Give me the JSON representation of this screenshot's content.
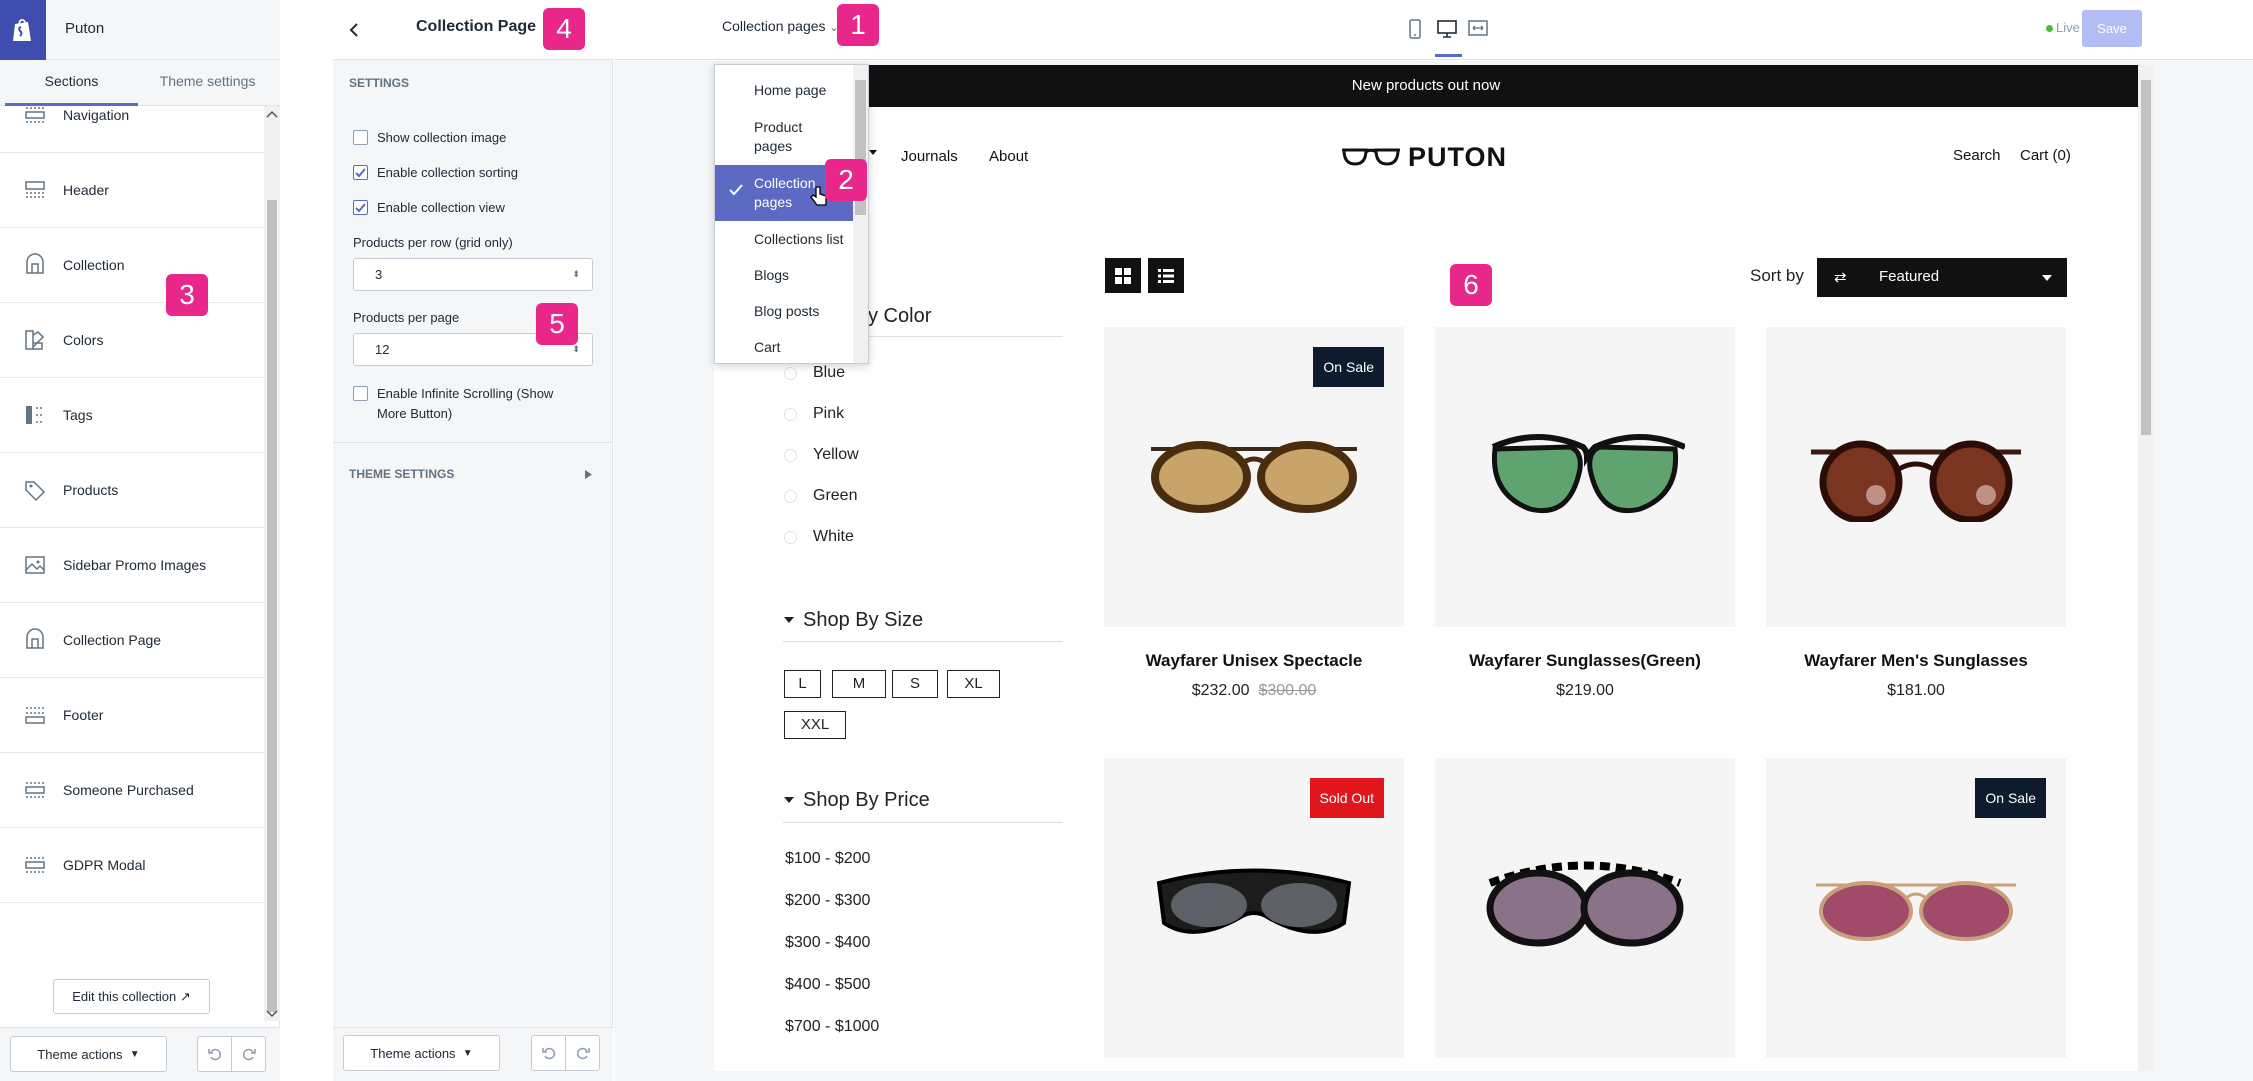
{
  "store": {
    "name": "Puton"
  },
  "left_tabs": [
    "Sections",
    "Theme settings"
  ],
  "sections": [
    {
      "label": "Navigation",
      "icon": "navigation-section-icon"
    },
    {
      "label": "Header",
      "icon": "header-section-icon"
    },
    {
      "label": "Collection",
      "icon": "collection-section-icon"
    },
    {
      "label": "Colors",
      "icon": "colors-section-icon"
    },
    {
      "label": "Tags",
      "icon": "tags-section-icon"
    },
    {
      "label": "Products",
      "icon": "products-tag-icon"
    },
    {
      "label": "Sidebar Promo Images",
      "icon": "image-icon"
    },
    {
      "label": "Collection Page",
      "icon": "collection-page-section-icon"
    },
    {
      "label": "Footer",
      "icon": "footer-section-icon"
    },
    {
      "label": "Someone Purchased",
      "icon": "someone-purchased-section-icon"
    },
    {
      "label": "GDPR Modal",
      "icon": "gdpr-section-icon"
    }
  ],
  "left_footer": {
    "edit_collection": "Edit this collection",
    "theme_actions": "Theme actions"
  },
  "panel": {
    "title": "Collection Page",
    "settings_label": "SETTINGS",
    "checkboxes": [
      {
        "label": "Show collection image",
        "checked": false
      },
      {
        "label": "Enable collection sorting",
        "checked": true
      },
      {
        "label": "Enable collection view",
        "checked": true
      }
    ],
    "per_row_label": "Products per row (grid only)",
    "per_row_value": "3",
    "per_page_label": "Products per page",
    "per_page_value": "12",
    "infinite_label_1": "Enable Infinite Scrolling (Show",
    "infinite_label_2": "More Button)",
    "infinite_checked": false,
    "theme_settings_label": "THEME SETTINGS",
    "theme_actions": "Theme actions"
  },
  "topbar": {
    "page_selector": "Collection pages",
    "live": "Live",
    "save": "Save"
  },
  "dropdown": {
    "items": [
      "Home page",
      "Product pages",
      "Collection pages",
      "Collections list",
      "Blogs",
      "Blog posts",
      "Cart"
    ],
    "selected": "Collection pages"
  },
  "store_preview": {
    "announcement": "New products out now",
    "nav_left": [
      "Journals",
      "About"
    ],
    "logo": "PUTON",
    "nav_right": [
      "Search",
      "Cart (0)"
    ],
    "filter_color_title": "Shop By Color",
    "filter_color_title_visible": "y Color",
    "colors": [
      "Blue",
      "Pink",
      "Yellow",
      "Green",
      "White"
    ],
    "filter_size_title": "Shop By Size",
    "sizes": [
      "L",
      "M",
      "S",
      "XL",
      "XXL"
    ],
    "filter_price_title": "Shop By Price",
    "prices": [
      "$100 - $200",
      "$200 - $300",
      "$300 - $400",
      "$400 - $500",
      "$700 - $1000"
    ],
    "sort_by": "Sort by",
    "sort_value": "Featured",
    "products": [
      {
        "title": "Wayfarer Unisex Spectacle",
        "price": "$232.00",
        "compare_price": "$300.00",
        "badge": "On Sale"
      },
      {
        "title": "Wayfarer Sunglasses(Green)",
        "price": "$219.00",
        "badge": ""
      },
      {
        "title": "Wayfarer Men's Sunglasses",
        "price": "$181.00",
        "badge": ""
      },
      {
        "title": "",
        "price": "",
        "badge": "Sold Out"
      },
      {
        "title": "",
        "price": "",
        "badge": ""
      },
      {
        "title": "",
        "price": "",
        "badge": "On Sale"
      }
    ]
  },
  "callouts": [
    "1",
    "2",
    "3",
    "4",
    "5",
    "6"
  ],
  "colors": {
    "accent": "#5c6ac4",
    "callout": "#e9268a",
    "sale_badge": "#0e1b2e",
    "sold_out_badge": "#e0161c",
    "live": "#50b83c"
  }
}
